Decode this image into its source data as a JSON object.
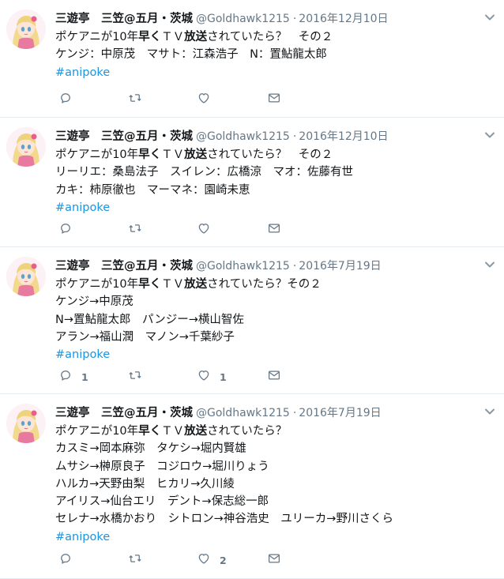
{
  "account": {
    "display_name": "三遊亭　三笠@五月・茨城",
    "handle": "@Goldhawk1215",
    "separator": "·"
  },
  "icons": {
    "reply": "reply-icon",
    "retweet": "retweet-icon",
    "like": "heart-icon",
    "dm": "envelope-icon",
    "menu": "chevron-down-icon"
  },
  "colors": {
    "text": "#14171a",
    "muted": "#657786",
    "hashtag": "#1b95e0",
    "divider": "#e6ecf0"
  },
  "tweets": [
    {
      "date": "2016年12月10日",
      "lines": [
        [
          "ポケアニが10年",
          "早く",
          "ＴＶ",
          "放送",
          "されていたら？　その２"
        ],
        [
          "ケンジ：中原茂　マサト：江森浩子　N：置鮎龍太郎"
        ]
      ],
      "hashtag": "#anipoke",
      "counts": {
        "reply": "",
        "retweet": "",
        "like": ""
      }
    },
    {
      "date": "2016年12月10日",
      "lines": [
        [
          "ポケアニが10年",
          "早く",
          "ＴＶ",
          "放送",
          "されていたら？　その２"
        ],
        [
          "リーリエ：桑島法子　スイレン：広橋涼　マオ：佐藤有世"
        ],
        [
          "カキ：柿原徹也　マーマネ：園崎未恵"
        ]
      ],
      "hashtag": "#anipoke",
      "counts": {
        "reply": "",
        "retweet": "",
        "like": ""
      }
    },
    {
      "date": "2016年7月19日",
      "lines": [
        [
          "ポケアニが10年",
          "早く",
          "ＴＶ",
          "放送",
          "されていたら？その２"
        ],
        [
          "ケンジ→中原茂"
        ],
        [
          "N→置鮎龍太郎　パンジー→横山智佐"
        ],
        [
          "アラン→福山潤　マノン→千葉紗子"
        ]
      ],
      "hashtag": "#anipoke",
      "counts": {
        "reply": "1",
        "retweet": "",
        "like": "1"
      }
    },
    {
      "date": "2016年7月19日",
      "lines": [
        [
          "ポケアニが10年",
          "早く",
          "ＴＶ",
          "放送",
          "されていたら？"
        ],
        [
          "カスミ→岡本麻弥　タケシ→堀内賢雄"
        ],
        [
          "ムサシ→榊原良子　コジロウ→堀川りょう"
        ],
        [
          "ハルカ→天野由梨　ヒカリ→久川綾"
        ],
        [
          "アイリス→仙台エリ　デント→保志総一郎"
        ],
        [
          "セレナ→水橋かおり　シトロン→神谷浩史　ユリーカ→野川さくら"
        ]
      ],
      "hashtag": "#anipoke",
      "counts": {
        "reply": "",
        "retweet": "",
        "like": "2"
      }
    }
  ]
}
